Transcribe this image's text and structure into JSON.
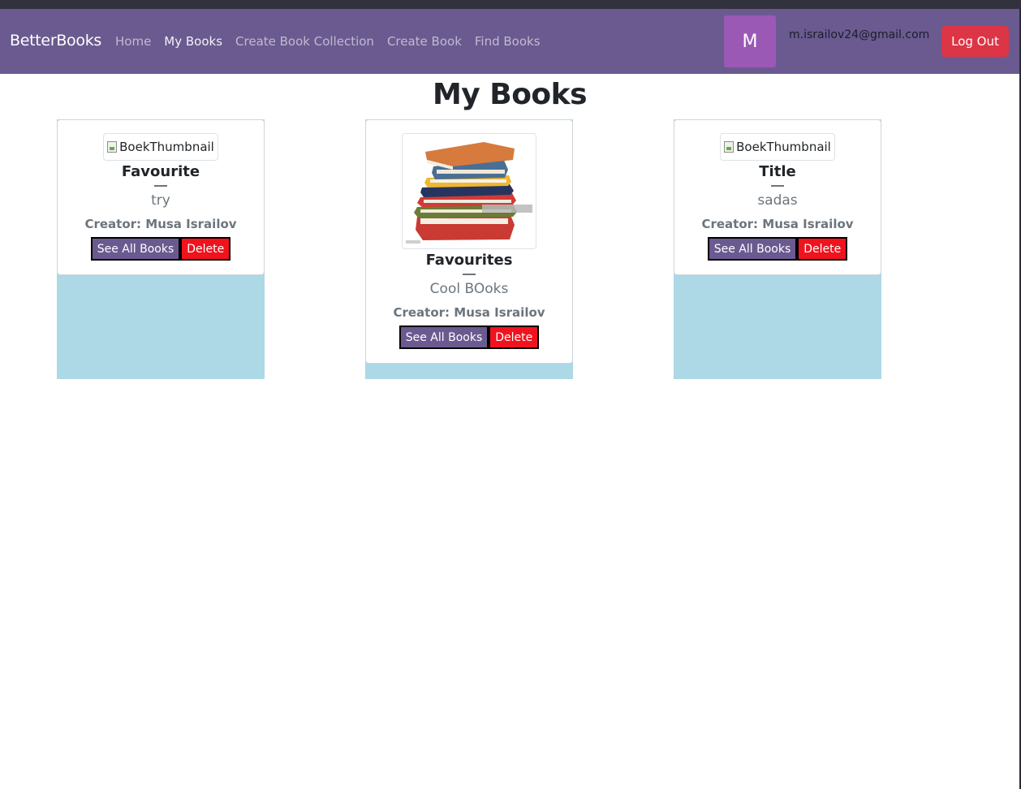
{
  "navbar": {
    "brand": "BetterBooks",
    "links": [
      {
        "label": "Home",
        "active": false
      },
      {
        "label": "My Books",
        "active": true
      },
      {
        "label": "Create Book Collection",
        "active": false
      },
      {
        "label": "Create Book",
        "active": false
      },
      {
        "label": "Find Books",
        "active": false
      }
    ],
    "avatar_initial": "M",
    "user_email": "m.israilov24@gmail.com",
    "logout_label": "Log Out",
    "colors": {
      "navbar": "#6a5a90",
      "avatar": "#9b59b6",
      "logout": "#dc3545"
    }
  },
  "page": {
    "title": "My Books"
  },
  "collections": [
    {
      "thumbnail_alt": "BoekThumbnail",
      "has_image": false,
      "title": "Favourite",
      "description": "try",
      "creator_label": "Creator:",
      "creator_name": "Musa Israilov",
      "see_all_label": "See All Books",
      "delete_label": "Delete"
    },
    {
      "thumbnail_alt": "BoekThumbnail",
      "has_image": true,
      "image_icon": "stack-of-books-image",
      "title": "Favourites",
      "description": "Cool BOoks",
      "creator_label": "Creator:",
      "creator_name": "Musa Israilov",
      "see_all_label": "See All Books",
      "delete_label": "Delete"
    },
    {
      "thumbnail_alt": "BoekThumbnail",
      "has_image": false,
      "title": "Title",
      "description": "sadas",
      "creator_label": "Creator:",
      "creator_name": "Musa Israilov",
      "see_all_label": "See All Books",
      "delete_label": "Delete"
    }
  ],
  "colors": {
    "column_background": "#add8e6",
    "see_all_button": "#6a5a90",
    "delete_button": "#f0131e"
  }
}
